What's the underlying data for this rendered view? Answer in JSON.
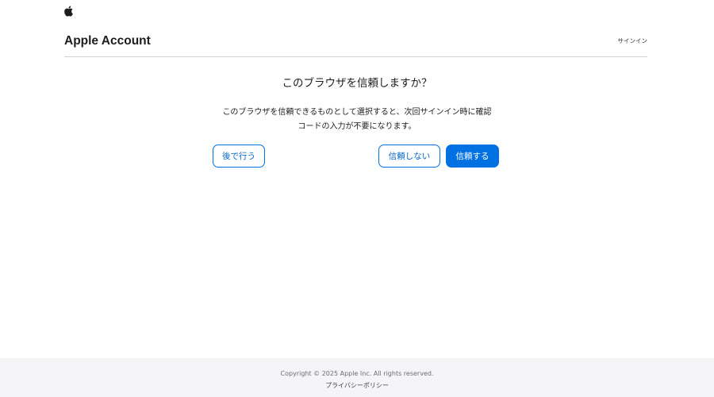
{
  "topbar": {
    "logo_icon": "apple-logo-icon"
  },
  "header": {
    "title": "Apple Account",
    "signin_label": "サインイン"
  },
  "dialog": {
    "question": "このブラウザを信頼しますか？",
    "description_line1": "このブラウザを信頼できるものとして選択すると、次回サインイン時に確認",
    "description_line2": "コードの入力が不要になります。",
    "later_label": "後で行う",
    "dont_trust_label": "信頼しない",
    "trust_label": "信頼する"
  },
  "footer": {
    "copyright": "Copyright © 2025 Apple Inc. All rights reserved.",
    "privacy_label": "プライバシーポリシー"
  },
  "colors": {
    "accent": "#0071e3",
    "text": "#1d1d1f",
    "footer_bg": "#f5f5f7",
    "divider": "#d2d2d7"
  }
}
